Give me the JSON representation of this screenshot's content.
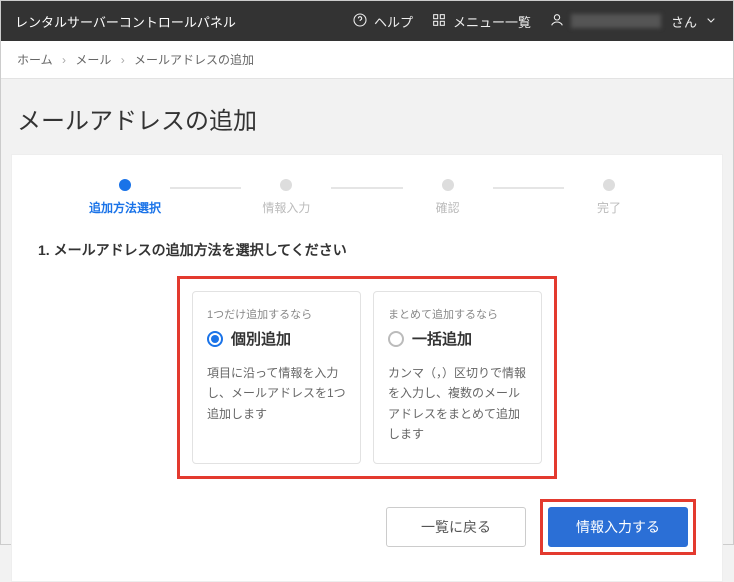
{
  "topbar": {
    "title": "レンタルサーバーコントロールパネル",
    "help": "ヘルプ",
    "menu": "メニュー一覧",
    "user_suffix": "さん"
  },
  "breadcrumb": {
    "home": "ホーム",
    "mail": "メール",
    "current": "メールアドレスの追加"
  },
  "page_title": "メールアドレスの追加",
  "stepper": {
    "steps": [
      {
        "label": "追加方法選択"
      },
      {
        "label": "情報入力"
      },
      {
        "label": "確認"
      },
      {
        "label": "完了"
      }
    ]
  },
  "section_header": "1. メールアドレスの追加方法を選択してください",
  "options": {
    "individual": {
      "lead": "1つだけ追加するなら",
      "title": "個別追加",
      "desc": "項目に沿って情報を入力し、メールアドレスを1つ追加します"
    },
    "bulk": {
      "lead": "まとめて追加するなら",
      "title": "一括追加",
      "desc": "カンマ（，）区切りで情報を入力し、複数のメールアドレスをまとめて追加します"
    }
  },
  "actions": {
    "back": "一覧に戻る",
    "next": "情報入力する"
  }
}
